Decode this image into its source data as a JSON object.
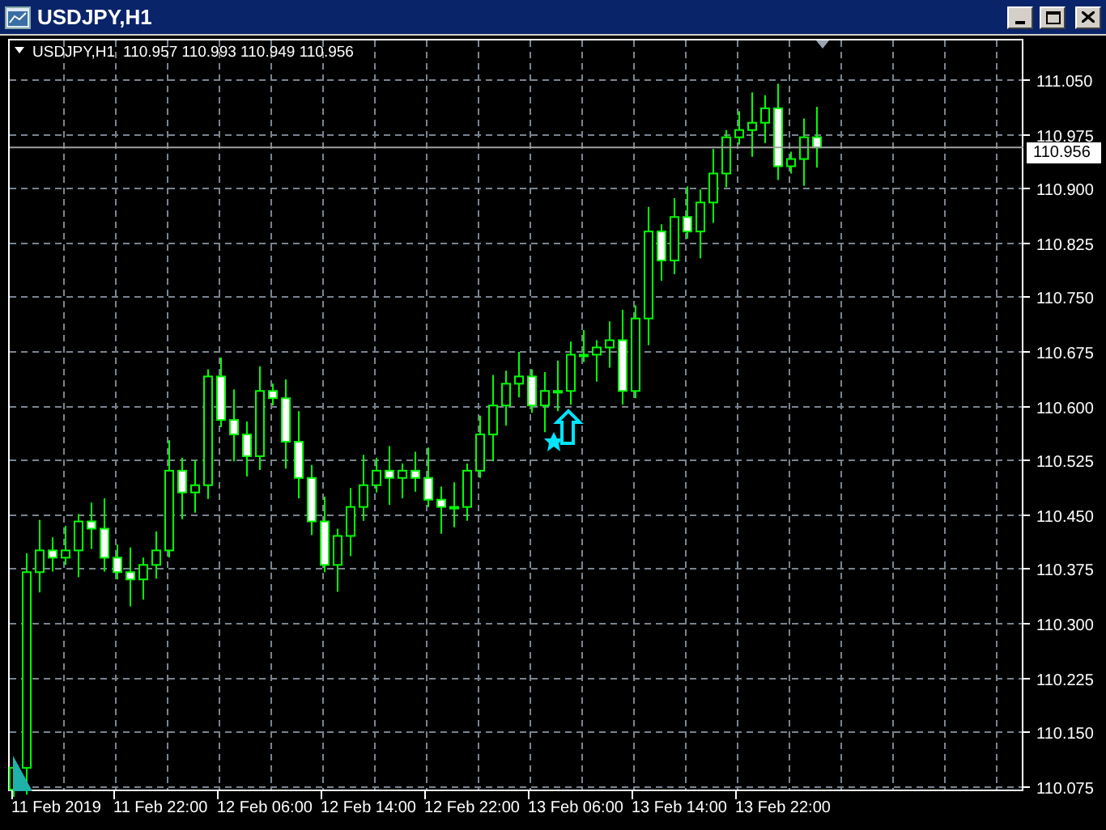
{
  "window": {
    "title": "USDJPY,H1"
  },
  "chart": {
    "symbol": "USDJPY,H1",
    "ohlc": "110.957 110.993 110.949 110.956",
    "current_price": "110.956",
    "price_axis": [
      "111.050",
      "110.975",
      "110.900",
      "110.825",
      "110.750",
      "110.675",
      "110.600",
      "110.525",
      "110.450",
      "110.375",
      "110.300",
      "110.225",
      "110.150",
      "110.075"
    ],
    "time_axis": [
      "11 Feb 2019",
      "11 Feb 22:00",
      "12 Feb 06:00",
      "12 Feb 14:00",
      "12 Feb 22:00",
      "13 Feb 06:00",
      "13 Feb 14:00",
      "13 Feb 22:00"
    ]
  }
}
